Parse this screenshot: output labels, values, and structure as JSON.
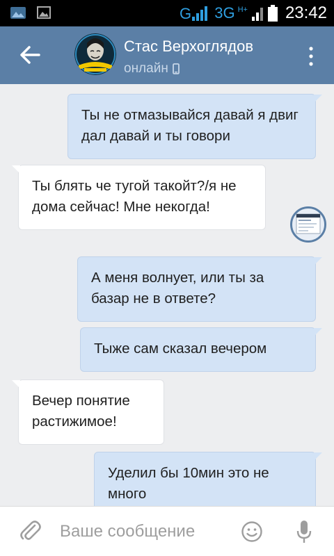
{
  "status_bar": {
    "network": "3G",
    "network_extra": "H+",
    "time": "23:42"
  },
  "header": {
    "title": "Стас Верхоглядов",
    "status": "онлайн",
    "avatar_text": "ТЫ КТО ТАКОЙ? ДАВАЙ"
  },
  "messages": [
    {
      "direction": "out",
      "text": "Ты не отмазывайся давай я двиг дал давай и ты говори"
    },
    {
      "direction": "in",
      "text": "Ты блять че тугой такойт?/я не дома сейчас! Мне некогда!"
    },
    {
      "direction": "out",
      "text": "А меня волнует, или ты за базар не в ответе?"
    },
    {
      "direction": "out",
      "text": "Тыже сам сказал вечером"
    },
    {
      "direction": "in",
      "text": "Вечер понятие растижимое!"
    },
    {
      "direction": "out",
      "text": "Уделил бы 10мин это не много"
    }
  ],
  "composer": {
    "placeholder": "Ваше сообщение"
  },
  "colors": {
    "header": "#5b7fa6",
    "out_bubble": "#d3e3f6",
    "in_bubble": "#ffffff",
    "background": "#edeef0"
  }
}
